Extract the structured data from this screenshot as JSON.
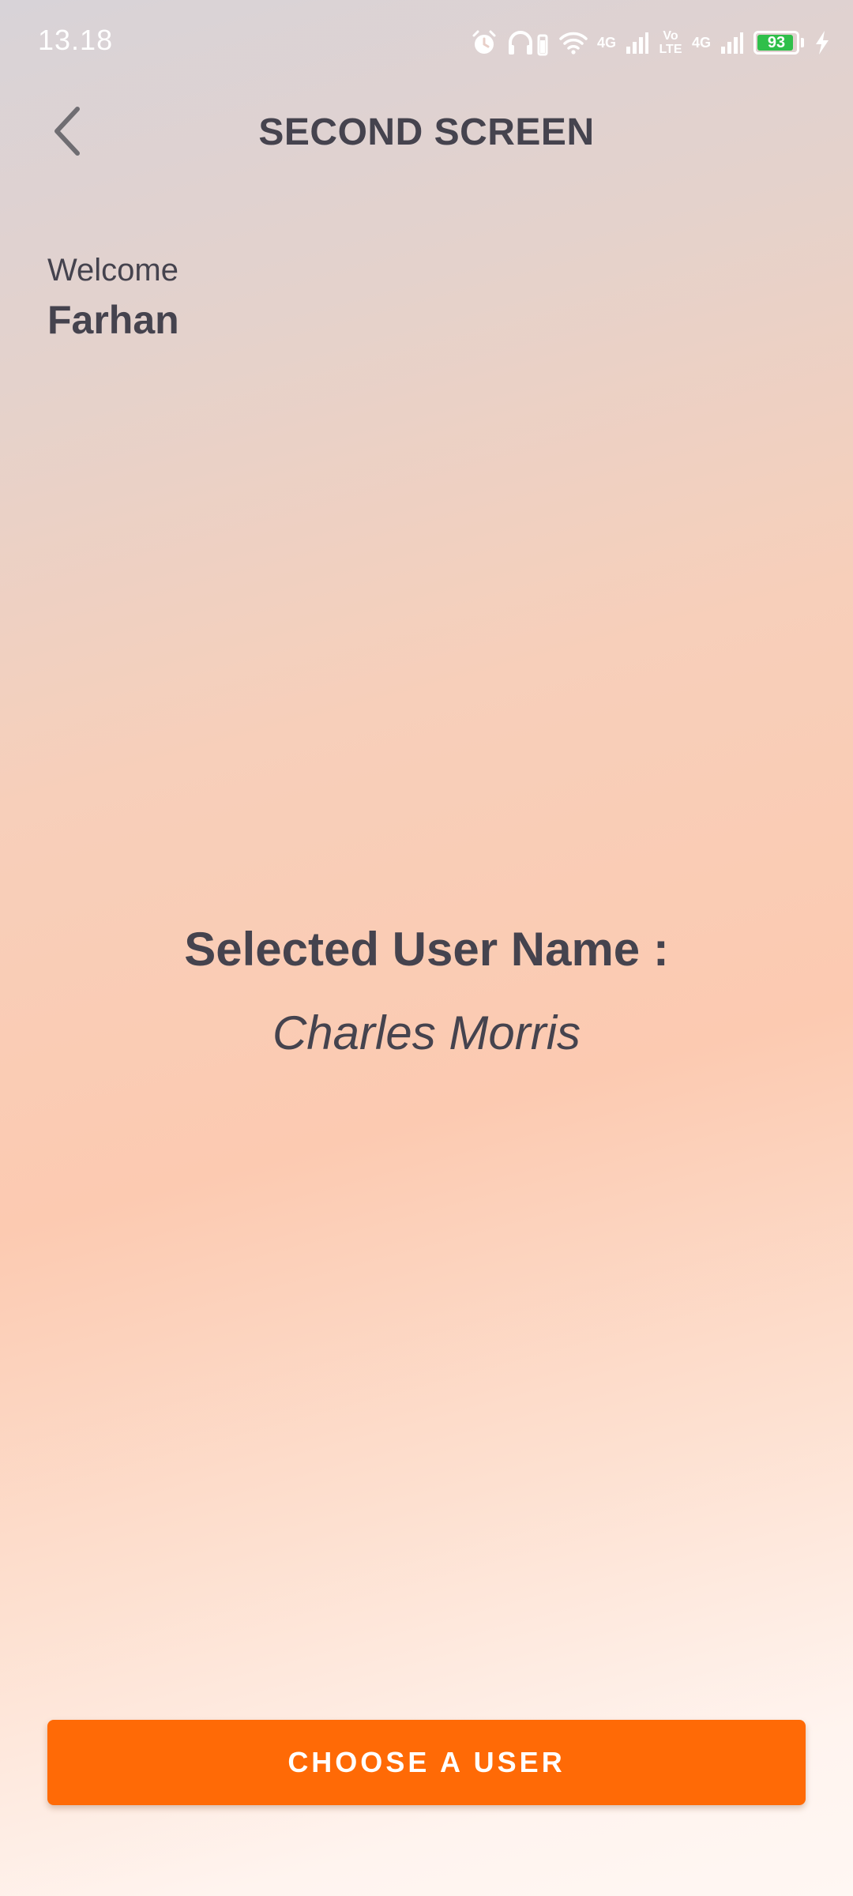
{
  "status_bar": {
    "time": "13.18",
    "network_1": "4G",
    "network_2": "Vo LTE",
    "network_3": "4G",
    "battery_level": "93",
    "battery_fraction": 0.93,
    "battery_color": "#2fbf4a",
    "icons": [
      "alarm-icon",
      "headphones-icon",
      "wifi-icon",
      "signal-icon",
      "volte-icon",
      "signal-icon",
      "battery-icon",
      "charging-icon"
    ]
  },
  "app_bar": {
    "title": "SECOND SCREEN",
    "back_icon": "chevron-left-icon"
  },
  "welcome": {
    "label": "Welcome",
    "name": "Farhan"
  },
  "selected_user": {
    "label": "Selected User Name :",
    "name": "Charles Morris"
  },
  "actions": {
    "choose_user_label": "CHOOSE A USER"
  },
  "colors": {
    "accent": "#ff6a06",
    "text": "#45434e"
  }
}
